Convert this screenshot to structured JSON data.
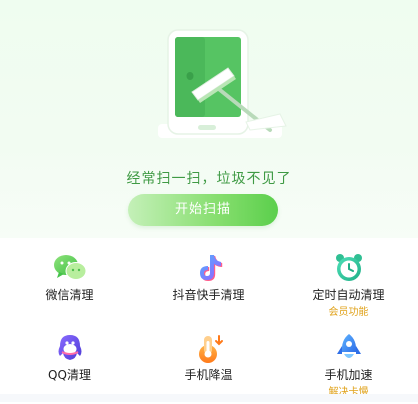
{
  "hero": {
    "slogan": "经常扫一扫，垃圾不见了",
    "scan_button": "开始扫描"
  },
  "features": [
    {
      "label": "微信清理",
      "sub": "",
      "icon": "wechat-icon"
    },
    {
      "label": "抖音快手清理",
      "sub": "",
      "icon": "tiktok-icon"
    },
    {
      "label": "定时自动清理",
      "sub": "会员功能",
      "icon": "alarm-clock-icon"
    },
    {
      "label": "QQ清理",
      "sub": "",
      "icon": "qq-penguin-icon"
    },
    {
      "label": "手机降温",
      "sub": "",
      "icon": "thermometer-icon"
    },
    {
      "label": "手机加速",
      "sub": "解决卡慢",
      "icon": "rocket-icon"
    }
  ],
  "colors": {
    "brand_green": "#5bcf4c",
    "slogan_green": "#3f9a44",
    "badge_gold": "#e0a21a"
  }
}
